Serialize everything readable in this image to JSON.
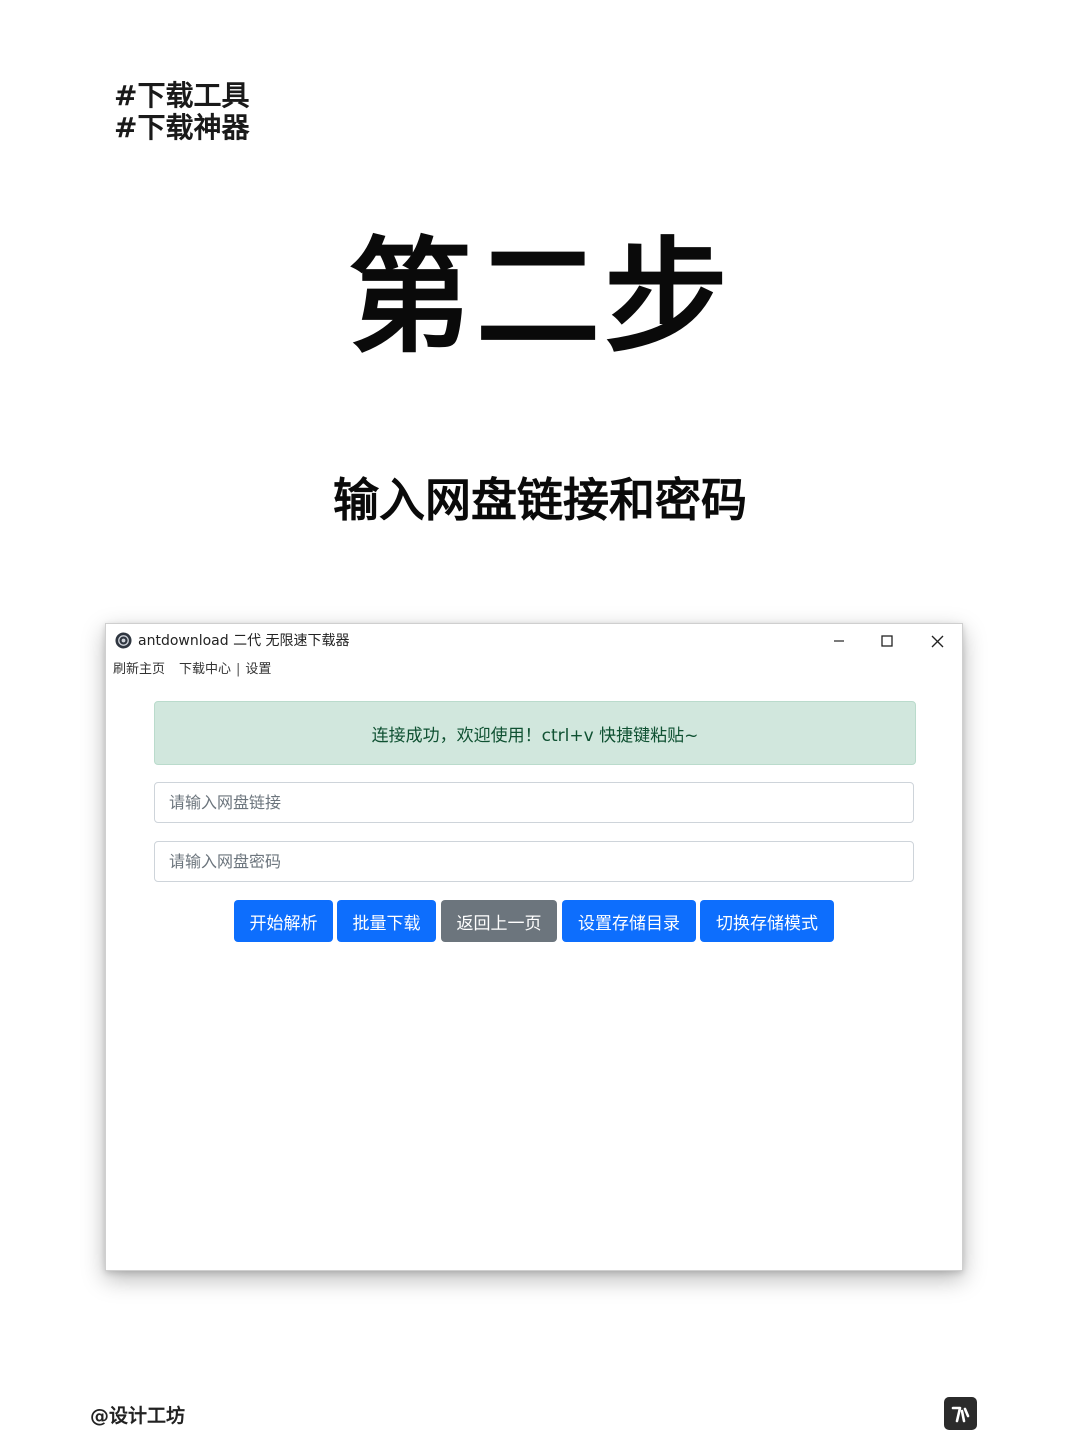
{
  "post": {
    "tags": [
      "#下载工具",
      "#下载神器"
    ],
    "step_title": "第二步",
    "subtitle": "输入网盘链接和密码",
    "credit": "@设计工坊",
    "logo_icon": "brand-logo-icon"
  },
  "window": {
    "title": "antdownload 二代 无限速下载器",
    "app_icon": "app-logo-icon",
    "controls": {
      "minimize": "minimize-icon",
      "maximize": "maximize-icon",
      "close": "close-icon"
    },
    "menu": {
      "refresh": "刷新主页",
      "downloads": "下载中心",
      "separator": "|",
      "settings": "设置"
    },
    "alert": {
      "text": "连接成功，欢迎使用！ctrl+v 快捷键粘贴~",
      "bg_color": "#d1e7dd",
      "text_color": "#0f5132"
    },
    "inputs": {
      "link": {
        "placeholder": "请输入网盘链接",
        "value": ""
      },
      "password": {
        "placeholder": "请输入网盘密码",
        "value": ""
      }
    },
    "buttons": {
      "parse": "开始解析",
      "batch": "批量下载",
      "back": "返回上一页",
      "set_dir": "设置存储目录",
      "switch_mode": "切换存储模式"
    },
    "colors": {
      "primary": "#0d6efd",
      "secondary": "#6c757d"
    }
  }
}
